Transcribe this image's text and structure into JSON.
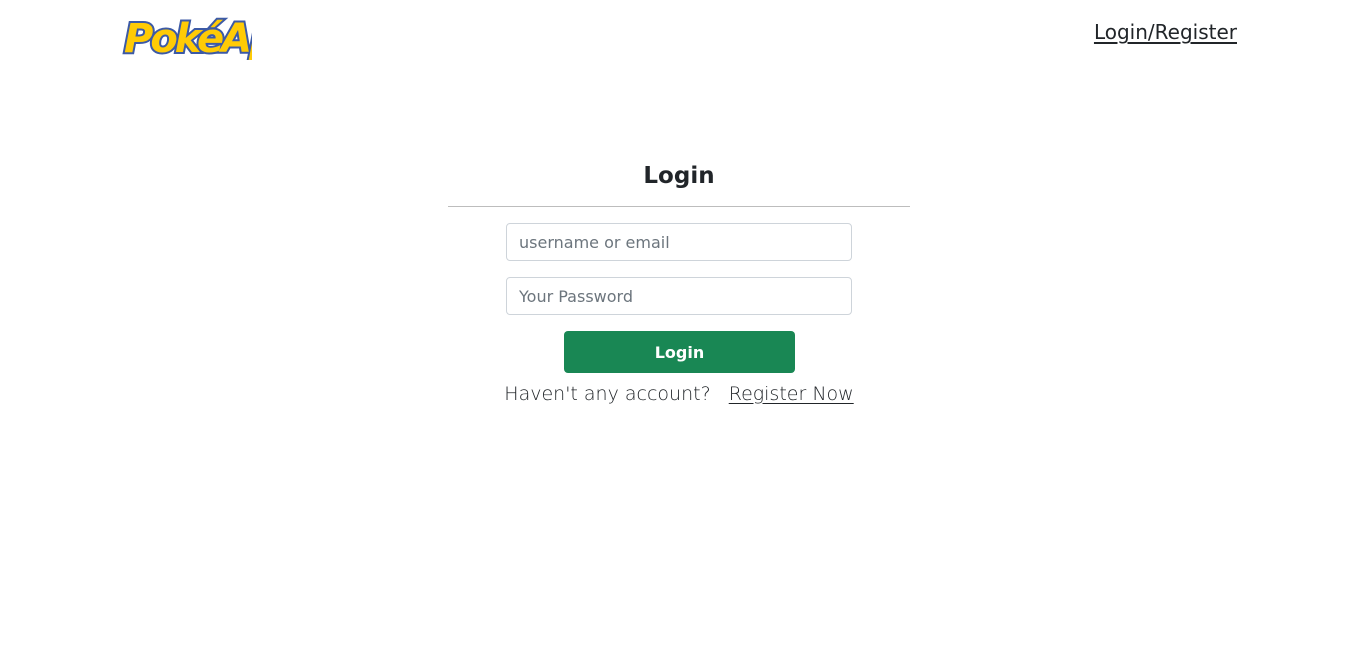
{
  "header": {
    "logo_alt": "PokéAPI",
    "nav_link": "Login/Register"
  },
  "login": {
    "title": "Login",
    "username_placeholder": "username or email",
    "password_placeholder": "Your Password",
    "submit_label": "Login",
    "register_prompt": "Haven't any account?",
    "register_link": "Register Now"
  },
  "colors": {
    "button_green": "#198754",
    "logo_yellow": "#FFCB05",
    "logo_blue": "#3C5AA6"
  }
}
